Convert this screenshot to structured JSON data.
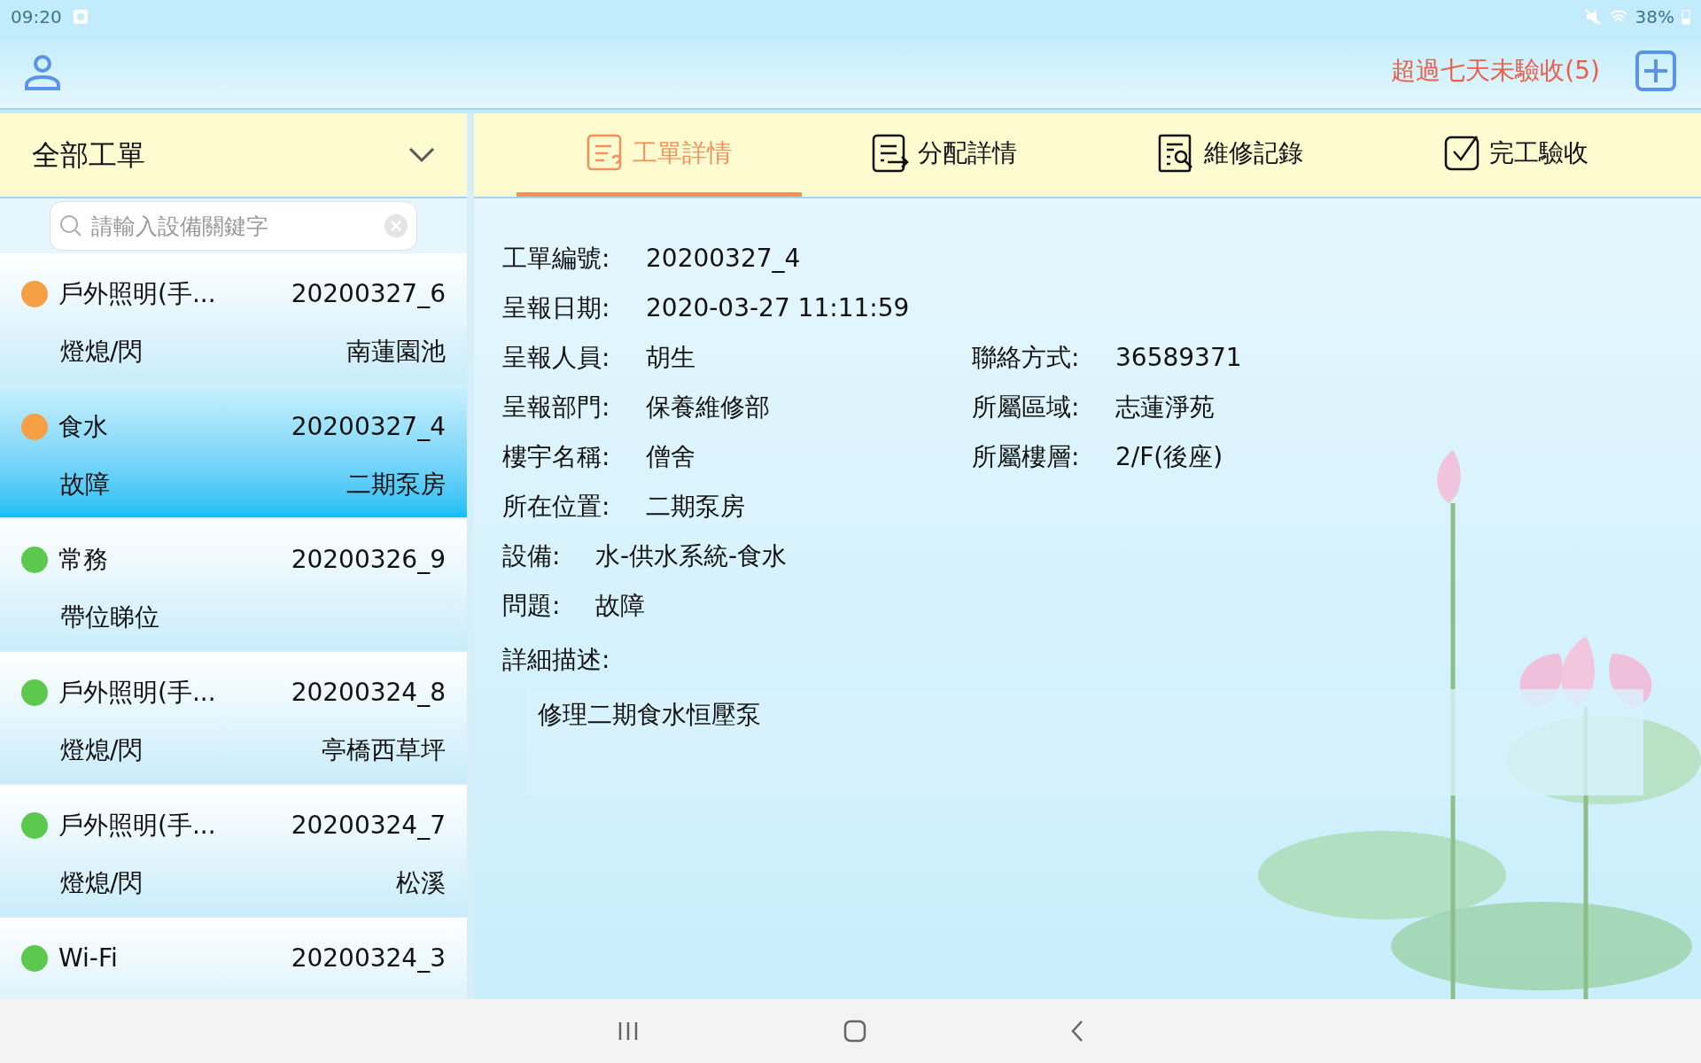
{
  "status_bar": {
    "time": "09:20",
    "battery": "38%"
  },
  "header": {
    "overdue_link": "超過七天未驗收(5)"
  },
  "filter": {
    "label": "全部工單"
  },
  "search": {
    "placeholder": "請輸入設備關鍵字"
  },
  "orders": [
    {
      "title": "戶外照明(手...",
      "code": "20200327_6",
      "problem": "燈熄/閃",
      "location": "南蓮園池",
      "color": "#f5a044",
      "selected": false
    },
    {
      "title": "食水",
      "code": "20200327_4",
      "problem": "故障",
      "location": "二期泵房",
      "color": "#f5a044",
      "selected": true
    },
    {
      "title": "常務",
      "code": "20200326_9",
      "problem": "帶位睇位",
      "color": "#5cc94e",
      "selected": false
    },
    {
      "title": "戶外照明(手...",
      "code": "20200324_8",
      "problem": "燈熄/閃",
      "location": "亭橋西草坪",
      "color": "#5cc94e",
      "selected": false
    },
    {
      "title": "戶外照明(手...",
      "code": "20200324_7",
      "problem": "燈熄/閃",
      "location": "松溪",
      "color": "#5cc94e",
      "selected": false
    },
    {
      "title": "Wi-Fi",
      "code": "20200324_3",
      "color": "#5cc94e",
      "selected": false
    }
  ],
  "tabs": [
    {
      "label": "工單詳情",
      "kind": "details",
      "selected": true
    },
    {
      "label": "分配詳情",
      "kind": "assign",
      "selected": false
    },
    {
      "label": "維修記錄",
      "kind": "repair",
      "selected": false
    },
    {
      "label": "完工驗收",
      "kind": "accept",
      "selected": false
    }
  ],
  "details": {
    "rows": [
      [
        {
          "label": "工單編號:",
          "value": "20200327_4"
        }
      ],
      [
        {
          "label": "呈報日期:",
          "value": "2020-03-27 11:11:59"
        }
      ],
      [
        {
          "label": "呈報人員:",
          "value": "胡生"
        },
        {
          "label": "聯絡方式:",
          "value": "36589371"
        }
      ],
      [
        {
          "label": "呈報部門:",
          "value": "保養維修部"
        },
        {
          "label": "所屬區域:",
          "value": "志蓮淨苑"
        }
      ],
      [
        {
          "label": "樓宇名稱:",
          "value": "僧舍"
        },
        {
          "label": "所屬樓層:",
          "value": "2/F(後座)"
        }
      ],
      [
        {
          "label": "所在位置:",
          "value": "二期泵房"
        }
      ],
      [
        {
          "label": "設備:",
          "value": "水-供水系統-食水",
          "kind": "short"
        }
      ],
      [
        {
          "label": "問題:",
          "value": "故障",
          "kind": "short"
        }
      ]
    ],
    "description_label": "詳細描述:",
    "description": "修理二期食水恒壓泵"
  }
}
